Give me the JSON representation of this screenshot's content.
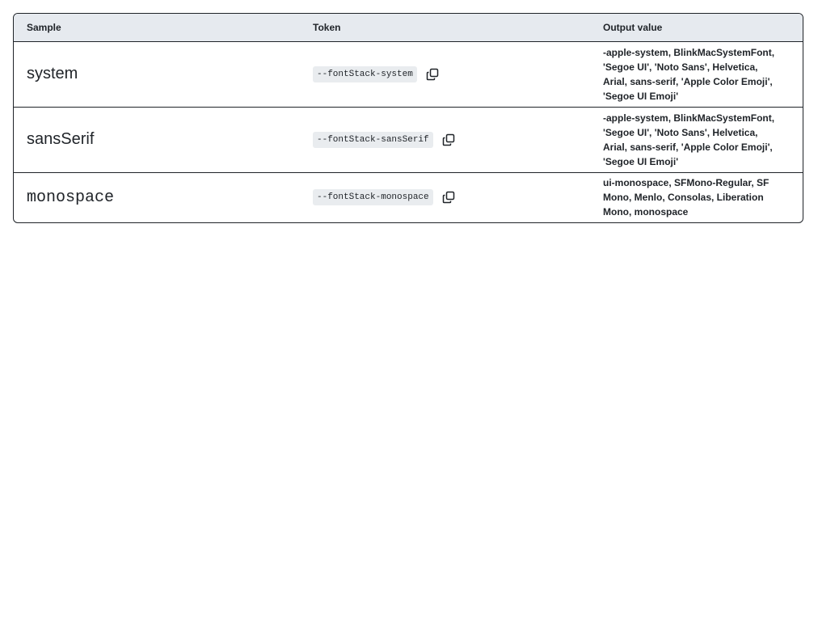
{
  "table": {
    "headers": {
      "sample": "Sample",
      "token": "Token",
      "output": "Output value"
    },
    "rows": [
      {
        "sample": "system",
        "token": "--fontStack-system",
        "value": "-apple-system, BlinkMacSystemFont, 'Segoe UI', 'Noto Sans', Helvetica, Arial, sans-serif, 'Apple Color Emoji', 'Segoe UI Emoji'"
      },
      {
        "sample": "sansSerif",
        "token": "--fontStack-sansSerif",
        "value": "-apple-system, BlinkMacSystemFont, 'Segoe UI', 'Noto Sans', Helvetica, Arial, sans-serif, 'Apple Color Emoji', 'Segoe UI Emoji'"
      },
      {
        "sample": "monospace",
        "token": "--fontStack-monospace",
        "value": "ui-monospace, SFMono-Regular, SF Mono, Menlo, Consolas, Liberation Mono, monospace"
      }
    ],
    "copy_icon": "copy-icon"
  }
}
